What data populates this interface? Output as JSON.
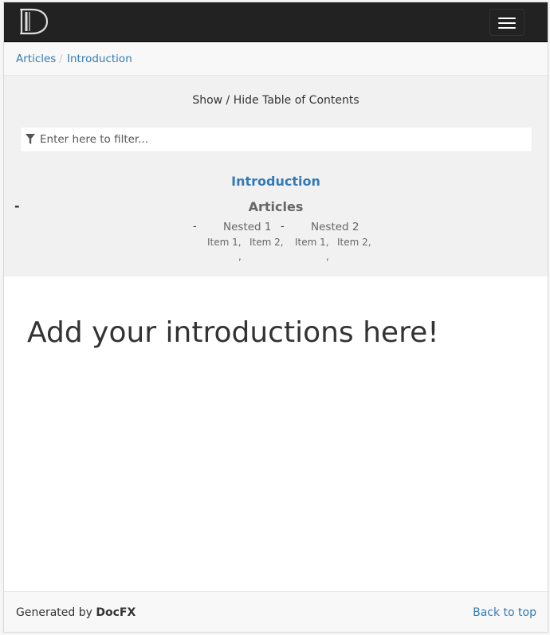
{
  "navbar": {
    "logo_icon": "docfx-d-logo-icon",
    "menu_icon": "hamburger-menu-icon"
  },
  "breadcrumb": {
    "items": [
      "Articles",
      "Introduction"
    ],
    "separator": "/"
  },
  "toc": {
    "toggle_label": "Show / Hide Table of Contents",
    "filter_placeholder": "Enter here to filter...",
    "filter_icon": "filter-icon",
    "introduction": "Introduction",
    "articles": {
      "expander": "-",
      "label": "Articles",
      "children": [
        {
          "expander": "-",
          "label": "Nested 1",
          "items": [
            "Item 1,",
            "Item 2,"
          ],
          "trailing": ","
        },
        {
          "expander": "-",
          "label": "Nested 2",
          "items": [
            "Item 1,",
            "Item 2,"
          ],
          "trailing": ","
        }
      ]
    }
  },
  "article": {
    "heading": "Add your introductions here!"
  },
  "footer": {
    "generated_prefix": "Generated by ",
    "generator_name": "DocFX",
    "back_to_top": "Back to top"
  },
  "colors": {
    "link": "#337ab7",
    "navbar_bg": "#222222",
    "toc_bg": "#f1f1f1"
  }
}
